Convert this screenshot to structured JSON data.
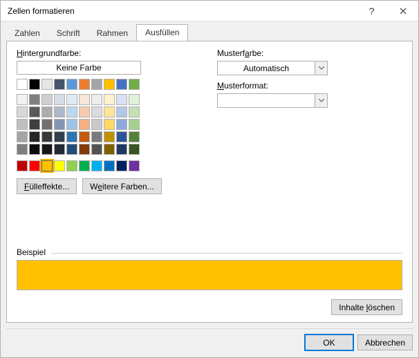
{
  "title": "Zellen formatieren",
  "tabs": [
    "Zahlen",
    "Schrift",
    "Rahmen",
    "Ausfüllen"
  ],
  "active_tab": 3,
  "left": {
    "bg_label": "Hintergrundfarbe:",
    "bg_underlined": "H",
    "no_color": "Keine Farbe",
    "theme_row": [
      "#ffffff",
      "#000000",
      "#e7e6e6",
      "#44546a",
      "#5b9bd5",
      "#ed7d31",
      "#a5a5a5",
      "#ffc000",
      "#4472c4",
      "#70ad47"
    ],
    "theme_shades": [
      [
        "#f2f2f2",
        "#7f7f7f",
        "#d0cece",
        "#d6dce4",
        "#deebf6",
        "#fbe5d5",
        "#ededed",
        "#fff2cc",
        "#d9e2f3",
        "#e2efd9"
      ],
      [
        "#d8d8d8",
        "#595959",
        "#aeabab",
        "#adb9ca",
        "#bdd7ee",
        "#f7cbac",
        "#dbdbdb",
        "#fee599",
        "#b4c6e7",
        "#c5e0b3"
      ],
      [
        "#bfbfbf",
        "#3f3f3f",
        "#757070",
        "#8496b0",
        "#9cc3e5",
        "#f4b183",
        "#c9c9c9",
        "#ffd965",
        "#8eaadb",
        "#a8d08d"
      ],
      [
        "#a5a5a5",
        "#262626",
        "#3a3838",
        "#323f4f",
        "#2e75b5",
        "#c55a11",
        "#7b7b7b",
        "#bf9000",
        "#2f5496",
        "#538135"
      ],
      [
        "#7f7f7f",
        "#0c0c0c",
        "#171616",
        "#222a35",
        "#1e4e79",
        "#833c0b",
        "#525252",
        "#7f6000",
        "#1f3864",
        "#375623"
      ]
    ],
    "standard": [
      "#c00000",
      "#ff0000",
      "#ffc000",
      "#ffff00",
      "#92d050",
      "#00b050",
      "#00b0f0",
      "#0070c0",
      "#002060",
      "#7030a0"
    ],
    "selected_standard_index": 2,
    "fill_effects": "Fülleffekte...",
    "fill_underlined": "F",
    "more_colors": "Weitere Farben...",
    "more_underlined": "e"
  },
  "right": {
    "pattern_color_label": "Musterfarbe:",
    "pattern_color_underlined": "a",
    "pattern_color_value": "Automatisch",
    "pattern_format_label": "Musterformat:",
    "pattern_format_underlined": "M",
    "pattern_format_value": ""
  },
  "sample": {
    "label": "Beispiel",
    "color": "#ffc000"
  },
  "clear_contents": "Inhalte löschen",
  "clear_underlined": "l",
  "ok": "OK",
  "cancel": "Abbrechen"
}
